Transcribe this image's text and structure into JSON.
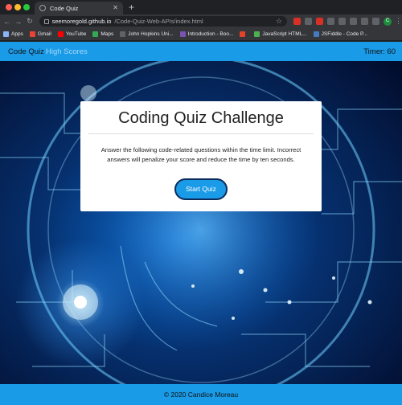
{
  "browser": {
    "tab_title": "Code Quiz",
    "url_host": "seemoregold.github.io",
    "url_path": "/Code-Quiz-Web-APIs/index.html",
    "bookmarks": [
      {
        "label": "Apps",
        "icon": "apps-grid-icon",
        "color": "#8ab4f8"
      },
      {
        "label": "Gmail",
        "icon": "gmail-icon",
        "color": "#ea4335"
      },
      {
        "label": "YouTube",
        "icon": "youtube-icon",
        "color": "#ff0000"
      },
      {
        "label": "Maps",
        "icon": "maps-icon",
        "color": "#34a853"
      },
      {
        "label": "John Hopkins Uni...",
        "icon": "folder-icon",
        "color": "#5f6368"
      },
      {
        "label": "Introduction - Boo...",
        "icon": "bootstrap-icon",
        "color": "#7952b3"
      },
      {
        "label": "",
        "icon": "gitlab-icon",
        "color": "#e24329"
      },
      {
        "label": "JavaScript HTML...",
        "icon": "w3-icon",
        "color": "#4caf50"
      },
      {
        "label": "JSFiddle - Code P...",
        "icon": "jsfiddle-icon",
        "color": "#4679bd"
      }
    ]
  },
  "navbar": {
    "brand": "Code Quiz",
    "link_high_scores": "High Scores",
    "timer": "Timer: 60"
  },
  "card": {
    "title": "Coding Quiz Challenge",
    "text": "Answer the following code-related questions within the time limit. Incorrect answers will penalize your score and reduce the time by ten seconds.",
    "button": "Start Quiz"
  },
  "footer": {
    "text": "© 2020 Candice Moreau"
  },
  "colors": {
    "accent": "#1a9be8",
    "button_border": "#0b2b5a"
  }
}
